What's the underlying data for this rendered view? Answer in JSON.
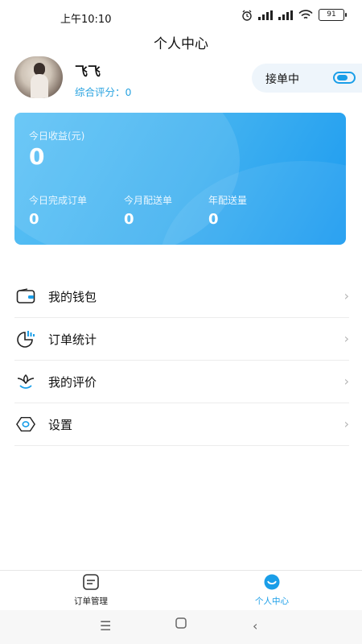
{
  "status_bar": {
    "time": "上午10:10",
    "battery": "91"
  },
  "header": {
    "title": "个人中心"
  },
  "profile": {
    "name": "飞飞",
    "rating_label": "综合评分：",
    "rating_value": "0",
    "order_toggle_label": "接单中",
    "order_toggle_on": true
  },
  "earnings": {
    "today_income_label": "今日收益(元)",
    "today_income_value": "0",
    "today_completed_label": "今日完成订单",
    "today_completed_value": "0",
    "month_delivery_label": "今月配送单",
    "month_delivery_value": "0",
    "year_delivery_label": "年配送量",
    "year_delivery_value": "0"
  },
  "menu": {
    "items": [
      {
        "label": "我的钱包",
        "icon": "wallet-icon"
      },
      {
        "label": "订单统计",
        "icon": "chart-icon"
      },
      {
        "label": "我的评价",
        "icon": "lotus-icon"
      },
      {
        "label": "设置",
        "icon": "settings-icon"
      }
    ]
  },
  "tabs": [
    {
      "label": "订单管理",
      "icon": "order-list-icon",
      "active": false
    },
    {
      "label": "个人中心",
      "icon": "smile-icon",
      "active": true
    }
  ],
  "colors": {
    "accent": "#1a9ee8",
    "card_start": "#5cc2f5",
    "card_end": "#1c9bf0"
  }
}
